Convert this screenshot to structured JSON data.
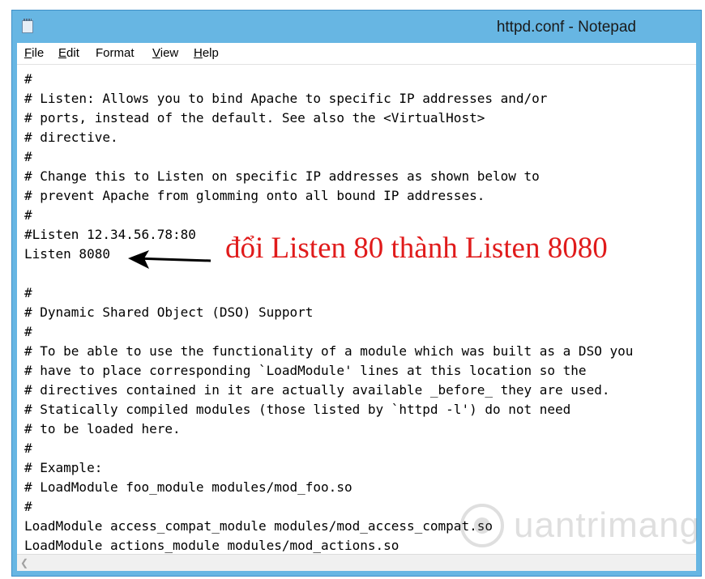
{
  "window": {
    "title": "httpd.conf - Notepad"
  },
  "menu": [
    {
      "underline": "F",
      "rest": "ile"
    },
    {
      "underline": "E",
      "rest": "dit"
    },
    {
      "underline": "",
      "rest": "Format",
      "underline_pos": 1
    },
    {
      "underline": "V",
      "rest": "iew"
    },
    {
      "underline": "H",
      "rest": "elp"
    }
  ],
  "editor": {
    "lines": [
      "#",
      "# Listen: Allows you to bind Apache to specific IP addresses and/or",
      "# ports, instead of the default. See also the <VirtualHost>",
      "# directive.",
      "#",
      "# Change this to Listen on specific IP addresses as shown below to",
      "# prevent Apache from glomming onto all bound IP addresses.",
      "#",
      "#Listen 12.34.56.78:80",
      "Listen 8080",
      "",
      "#",
      "# Dynamic Shared Object (DSO) Support",
      "#",
      "# To be able to use the functionality of a module which was built as a DSO you",
      "# have to place corresponding `LoadModule' lines at this location so the",
      "# directives contained in it are actually available _before_ they are used.",
      "# Statically compiled modules (those listed by `httpd -l') do not need",
      "# to be loaded here.",
      "#",
      "# Example:",
      "# LoadModule foo_module modules/mod_foo.so",
      "#",
      "LoadModule access_compat_module modules/mod_access_compat.so",
      "LoadModule actions_module modules/mod_actions.so"
    ]
  },
  "annotation": {
    "text": "đổi Listen 80 thành Listen 8080",
    "color": "#e01b1b"
  },
  "watermark": {
    "text": "uantrimang"
  },
  "colors": {
    "frame": "#67b6e3"
  }
}
